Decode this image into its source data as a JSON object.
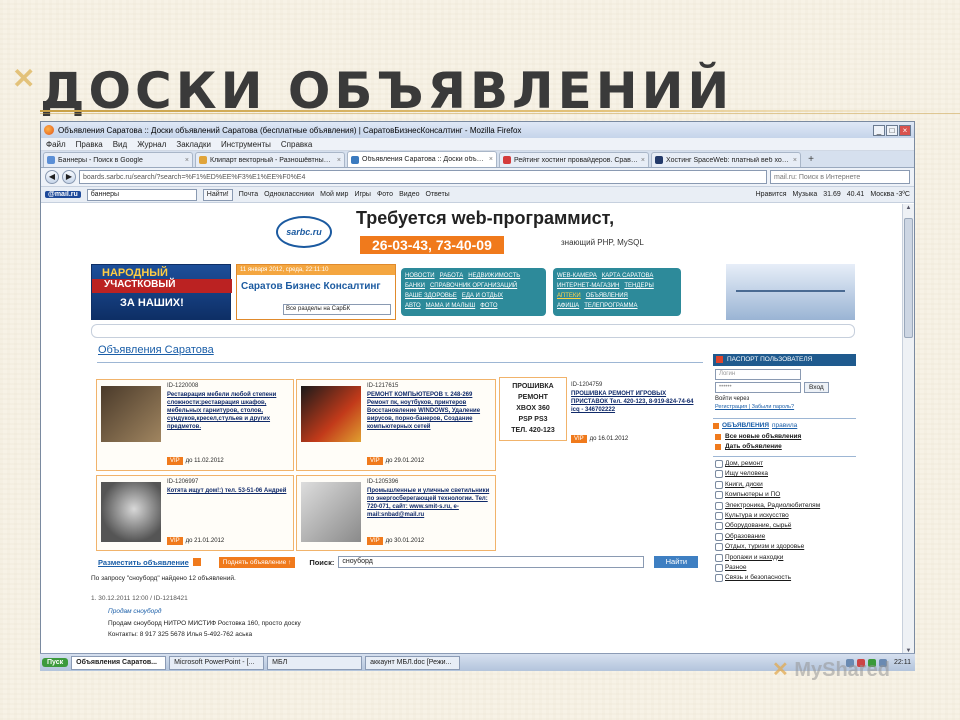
{
  "slide": {
    "title": "ДОСКИ ОБЪЯВЛЕНИЙ"
  },
  "browser": {
    "window_title": "Объявления Саратова :: Доски объявлений Саратова (бесплатные объявления) | СаратовБизнесКонсалтинг - Mozilla Firefox",
    "menu": [
      "Файл",
      "Правка",
      "Вид",
      "Журнал",
      "Закладки",
      "Инструменты",
      "Справка"
    ],
    "tabs": [
      {
        "label": "Баннеры - Поиск в Google",
        "active": false
      },
      {
        "label": "Клипарт векторный - Разношёвтные б...",
        "active": false
      },
      {
        "label": "Объявления Саратова :: Доски объяв...",
        "active": true
      },
      {
        "label": "Рейтинг хостинг провайдеров. Сравне...",
        "active": false
      },
      {
        "label": "Хостинг SpaceWeb: платный веб хости...",
        "active": false
      }
    ],
    "url": "boards.sarbc.ru/search/?search=%F1%ED%EE%F3%E1%EE%F0%E4",
    "search_placeholder": "mail.ru: Поиск в Интернете",
    "toolbar": {
      "brand": "@mail.ru",
      "search_value": "баннеры",
      "find_label": "Найти!",
      "items": [
        "Почта",
        "Одноклассники",
        "Мой мир",
        "Игры",
        "Фото",
        "Видео",
        "Ответы"
      ],
      "right": [
        "Нравится",
        "Музыка",
        "31.69",
        "40.41",
        "Москва -3ºC"
      ]
    }
  },
  "page": {
    "ad_banner": {
      "logo": "sarbc.ru",
      "headline": "Требуется web-программист,",
      "phone": "26-03-43, 73-40-09",
      "sub": "знающий PHP, MySQL"
    },
    "promo": {
      "line1": "НАРОДНЫЙ",
      "line2": "УЧАСТКОВЫЙ",
      "line3": "ЗА НАШИХ!"
    },
    "sbk": {
      "date": "11 января 2012, среда, 22:11:10",
      "logo": "Саратов Бизнес Консалтинг",
      "select": "Все разделы на СарБК"
    },
    "nav_left": [
      [
        "НОВОСТИ",
        "РАБОТА",
        "НЕДВИЖИМОСТЬ"
      ],
      [
        "БАНКИ",
        "СПРАВОЧНИК ОРГАНИЗАЦИЙ"
      ],
      [
        "ВАШЕ ЗДОРОВЬЕ",
        "ЕДА И ОТДЫХ"
      ],
      [
        "АВТО",
        "МАМА И МАЛЫШ",
        "ФОТО"
      ]
    ],
    "nav_right": [
      [
        "WEB-КАМЕРА",
        "КАРТА САРАТОВА"
      ],
      [
        "ИНТЕРНЕТ-МАГАЗИН",
        "ТЕНДЕРЫ"
      ],
      [
        "АПТЕКИ",
        "ОБЪЯВЛЕНИЯ"
      ],
      [
        "АФИША",
        "ТЕЛЕПРОГРАММА"
      ]
    ],
    "section_title": "Объявления Саратова",
    "ads": [
      {
        "id": "ID-1220008",
        "text": "Реставрация мебели любой степени сложности:реставрация шкафов, мебельных гарнитуров, столов, сундуков,кресел,стульев и других предметов.",
        "vip": "VIP",
        "until": "до 11.02.2012"
      },
      {
        "id": "ID-1217615",
        "text": "РЕМОНТ КОМПЬЮТЕРОВ т. 248-269 Ремонт пк, ноутбуков, принтеров Восстановление WINDOWS, Удаление вирусов, порно-банеров, Создание компьютерных сетей",
        "vip": "VIP",
        "until": "до 29.01.2012"
      },
      {
        "id": "ID-1204759",
        "text": "ПРОШИВКА РЕМОНТ ИГРОВЫХ ПРИСТАВОК Тел. 420-123, 8-919-824-74-64 icq - 346702222",
        "vip": "VIP",
        "until": "до 16.01.2012"
      },
      {
        "id": "ID-1206997",
        "text": "Котята ищут дом!:) тел. 53-51-06 Андрей",
        "vip": "VIP",
        "until": "до 21.01.2012"
      },
      {
        "id": "ID-1205396",
        "text": "Промышленные и уличные светильники по энергосберегающей технологии. Тел: 720-071, сайт: www.smit-s.ru, e-mail:snbad@mail.ru",
        "vip": "VIP",
        "until": "до 30.01.2012"
      }
    ],
    "proshivka_box": [
      "ПРОШИВКА",
      "РЕМОНТ",
      "XBOX 360",
      "PSP PS3",
      "ТЕЛ. 420-123"
    ],
    "place_link": "Разместить объявление",
    "raise_btn": "Поднять объявление ↑",
    "search_label": "Поиск:",
    "search_value": "сноуборд",
    "find_btn": "Найти",
    "result_summary": "По запросу \"сноуборд\" найдено 12 объявлений.",
    "result": {
      "meta": "1.    30.12.2011 12:00 / ID-1218421",
      "title": "Продам сноуборд",
      "text": "Продам сноуборд НИТРО МИСТИФ Ростовка 160, просто доску",
      "contact": "Контакты:  8 917 325 5678 Илья 5-492-762 аська"
    },
    "sidebar": {
      "passport": "ПАСПОРТ ПОЛЬЗОВАТЕЛЯ",
      "login_placeholder": "Логин",
      "password_value": "••••••",
      "enter_btn": "Вход",
      "via": "Войти через",
      "register": "Регистрация | Забыли пароль?",
      "cat_head": "ОБЪЯВЛЕНИЯ",
      "rules": "правила",
      "bold_links": [
        "Все новые объявления",
        "Дать объявление"
      ],
      "categories": [
        "Дом, ремонт",
        "Ищу человека",
        "Книги, диски",
        "Компьютеры и ПО",
        "Электроника, Радиолюбителям",
        "Культура и искусство",
        "Оборудование, сырьё",
        "Образование",
        "Отдых, туризм и здоровье",
        "Пропажи и находки",
        "Разное",
        "Связь и безопасность"
      ]
    }
  },
  "taskbar": {
    "start": "Пуск",
    "items": [
      {
        "label": "Объявления Саратов...",
        "active": true
      },
      {
        "label": "Microsoft PowerPoint - [...",
        "active": false
      },
      {
        "label": "МБЛ",
        "active": false
      },
      {
        "label": "аккаунт МБЛ.doc [Режи...",
        "active": false
      }
    ],
    "time": "22:11"
  },
  "watermark": "MyShared"
}
